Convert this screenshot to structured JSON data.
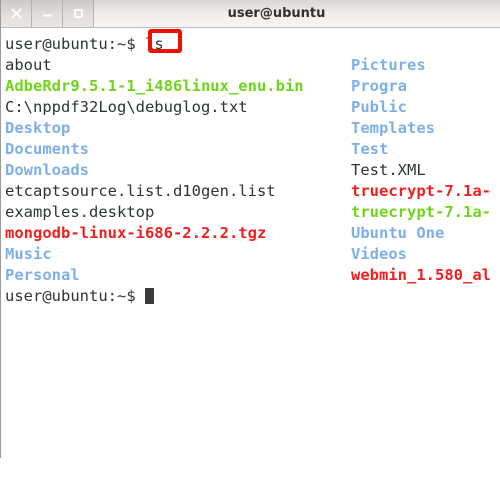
{
  "window": {
    "title": "user@ubuntu",
    "buttons": [
      {
        "name": "close",
        "glyph": "close-icon",
        "label": "×"
      },
      {
        "name": "minimize",
        "glyph": "minimize-icon",
        "label": "−"
      },
      {
        "name": "maximize",
        "glyph": "maximize-icon",
        "label": "□"
      }
    ]
  },
  "terminal": {
    "prompt": "user@ubuntu:~$ ",
    "command": "ls",
    "command_line": "user@ubuntu:~$ ls",
    "final_prompt": "user@ubuntu:~$ ",
    "cursor": "block",
    "colors": {
      "default_text": "#2e3436",
      "directory": "#7fafe8",
      "executable": "#6fd41b",
      "archive": "#ef2020",
      "background": "#ffffff",
      "annotation": "#f01000"
    },
    "left_column": [
      {
        "text": "about",
        "type": "default"
      },
      {
        "text": "AdbeRdr9.5.1-1_i486linux_enu.bin",
        "type": "exec"
      },
      {
        "text": "C:\\nppdf32Log\\debuglog.txt",
        "type": "default"
      },
      {
        "text": "Desktop",
        "type": "dir"
      },
      {
        "text": "Documents",
        "type": "dir"
      },
      {
        "text": "Downloads",
        "type": "dir"
      },
      {
        "text": "etcaptsource.list.d10gen.list",
        "type": "default"
      },
      {
        "text": "examples.desktop",
        "type": "default"
      },
      {
        "text": "mongodb-linux-i686-2.2.2.tgz",
        "type": "arch"
      },
      {
        "text": "Music",
        "type": "dir"
      },
      {
        "text": "Personal",
        "type": "dir"
      }
    ],
    "right_column": [
      {
        "text": "Pictures",
        "type": "dir"
      },
      {
        "text": "Progra",
        "type": "dir"
      },
      {
        "text": "Public",
        "type": "dir"
      },
      {
        "text": "Templates",
        "type": "dir"
      },
      {
        "text": "Test",
        "type": "dir"
      },
      {
        "text": "Test.XML",
        "type": "default"
      },
      {
        "text": "truecrypt-7.1a-",
        "type": "arch"
      },
      {
        "text": "truecrypt-7.1a-",
        "type": "exec"
      },
      {
        "text": "Ubuntu One",
        "type": "dir"
      },
      {
        "text": "Videos",
        "type": "dir"
      },
      {
        "text": "webmin_1.580_al",
        "type": "arch"
      }
    ]
  }
}
